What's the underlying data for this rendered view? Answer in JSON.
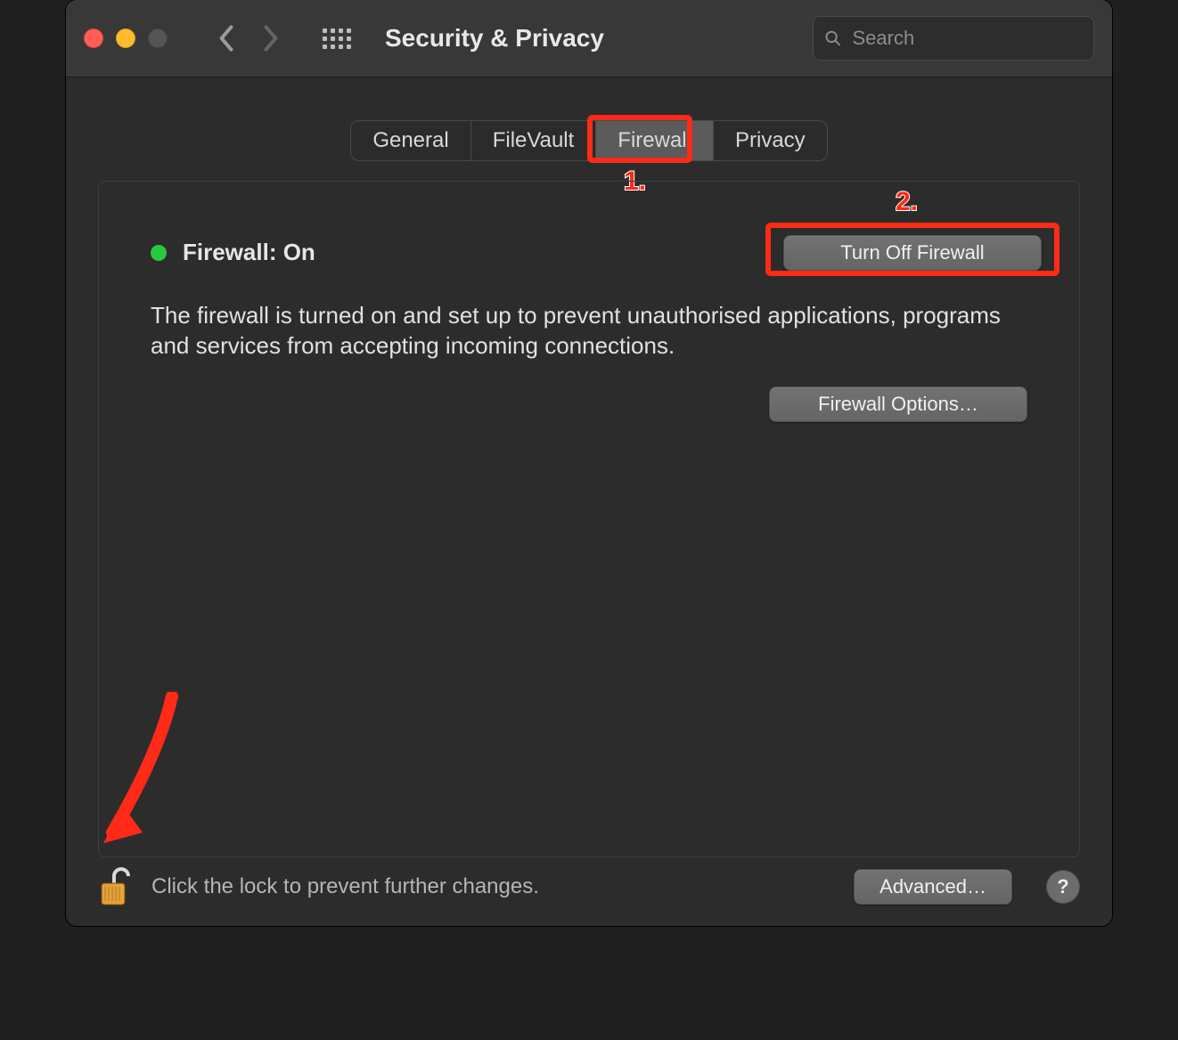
{
  "header": {
    "title": "Security & Privacy",
    "search_placeholder": "Search"
  },
  "tabs": [
    {
      "label": "General"
    },
    {
      "label": "FileVault"
    },
    {
      "label": "Firewall",
      "active": true
    },
    {
      "label": "Privacy"
    }
  ],
  "firewall": {
    "status_label": "Firewall: On",
    "status_color": "#27c93f",
    "turn_off_label": "Turn Off Firewall",
    "description": "The firewall is turned on and set up to prevent unauthorised applications, programs and services from accepting incoming connections.",
    "options_label": "Firewall Options…"
  },
  "footer": {
    "lock_text": "Click the lock to prevent further changes.",
    "advanced_label": "Advanced…",
    "help_label": "?"
  },
  "annotations": {
    "callout1": "1.",
    "callout2": "2."
  }
}
